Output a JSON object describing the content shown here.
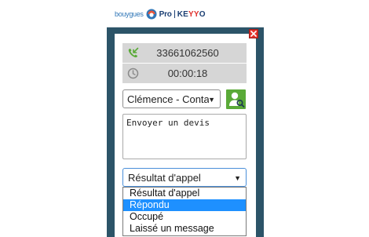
{
  "header": {
    "brand_bouygues": "bouygues",
    "brand_pro": "Pro",
    "brand_keyyo_a": "KE",
    "brand_keyyo_b": "YY",
    "brand_keyyo_c": "O"
  },
  "call": {
    "phone_number": "33661062560",
    "duration": "00:00:18"
  },
  "contact": {
    "selected": "Clémence - Conta"
  },
  "notes": {
    "value": "Envoyer un devis"
  },
  "result": {
    "selected": "Résultat d'appel",
    "options": [
      "Résultat d'appel",
      "Répondu",
      "Occupé",
      "Laissé un message"
    ],
    "highlighted_index": 1
  },
  "colors": {
    "frame": "#2c5468",
    "close": "#e3312b",
    "contact_button": "#5aaa38",
    "highlight": "#1e90ff",
    "phone_icon": "#5aaa38",
    "clock_icon": "#8a8a8a"
  },
  "icons": {
    "close": "close-icon",
    "phone": "phone-incoming-icon",
    "clock": "clock-icon",
    "contact_search": "contact-search-icon",
    "caret": "chevron-down-icon"
  }
}
